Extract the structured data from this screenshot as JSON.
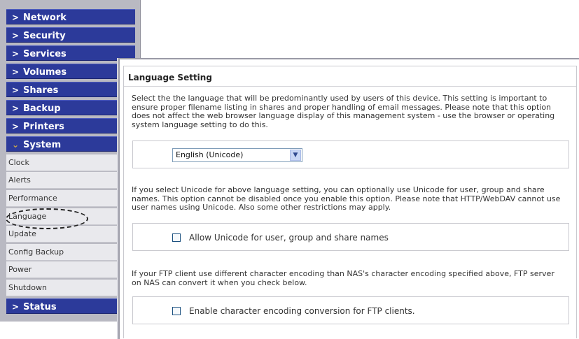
{
  "sidebar": {
    "top_items": [
      {
        "label": "Network"
      },
      {
        "label": "Security"
      },
      {
        "label": "Services"
      },
      {
        "label": "Volumes"
      },
      {
        "label": "Shares"
      },
      {
        "label": "Backup"
      },
      {
        "label": "Printers"
      }
    ],
    "open_item": {
      "label": "System"
    },
    "sub_items": [
      {
        "label": "Clock"
      },
      {
        "label": "Alerts"
      },
      {
        "label": "Performance"
      },
      {
        "label": "Language"
      },
      {
        "label": "Update"
      },
      {
        "label": "Config Backup"
      },
      {
        "label": "Power"
      },
      {
        "label": "Shutdown"
      }
    ],
    "bottom_item": {
      "label": "Status"
    }
  },
  "panel": {
    "title": "Language Setting",
    "intro_text": "Select the the language that will be predominantly used by users of this device. This setting is important to ensure proper filename listing in shares and proper handling of email messages. Please note that this option does not affect the web browser language display of this management system - use the browser or operating system language setting to do this.",
    "language_select": {
      "value": "English (Unicode)"
    },
    "unicode_text": "If you select Unicode for above language setting, you can optionally use Unicode for user, group and share names. This option cannot be disabled once you enable this option. Please note that HTTP/WebDAV cannot use user names using Unicode. Also some other restrictions may apply.",
    "unicode_checkbox": {
      "label": "Allow Unicode for user, group and share names",
      "checked": false
    },
    "ftp_text": "If your FTP client use different character encoding than NAS's character encoding specified above, FTP server on NAS can convert it when you check below.",
    "ftp_checkbox": {
      "label": "Enable character encoding conversion for FTP clients.",
      "checked": false
    }
  },
  "icons": {
    "collapsed": "chevron-right-icon",
    "expanded": "chevron-down-icon",
    "dropdown": "dropdown-arrow-icon"
  },
  "colors": {
    "nav_bg": "#2c3a9a",
    "nav_text": "#ffffff",
    "sub_bg": "#e9e9ed",
    "expanded_arrow": "#c9a64b"
  }
}
